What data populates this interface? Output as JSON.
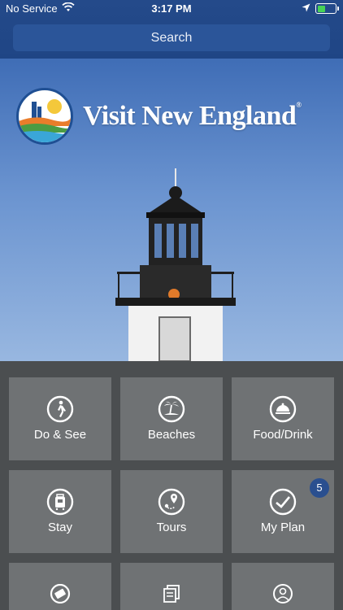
{
  "status_bar": {
    "carrier": "No Service",
    "time": "3:17 PM",
    "battery_level": 0.45
  },
  "search": {
    "placeholder": "Search"
  },
  "hero": {
    "logo_text": "Visit New England",
    "logo_mark": "®"
  },
  "tiles": [
    {
      "label": "Do & See",
      "icon": "walking-person-icon"
    },
    {
      "label": "Beaches",
      "icon": "palm-island-icon"
    },
    {
      "label": "Food/Drink",
      "icon": "serving-dish-icon"
    },
    {
      "label": "Stay",
      "icon": "luggage-icon"
    },
    {
      "label": "Tours",
      "icon": "map-pin-route-icon"
    },
    {
      "label": "My Plan",
      "icon": "checkmark-circle-icon",
      "badge": "5"
    },
    {
      "label": "",
      "icon": "ticket-icon"
    },
    {
      "label": "",
      "icon": "brochures-icon"
    },
    {
      "label": "",
      "icon": "profile-icon"
    }
  ],
  "colors": {
    "header": "#1f4585",
    "tile": "#6f7274",
    "grid_bg": "#4b4e50",
    "badge": "#2a4f8f",
    "battery": "#46d356"
  }
}
